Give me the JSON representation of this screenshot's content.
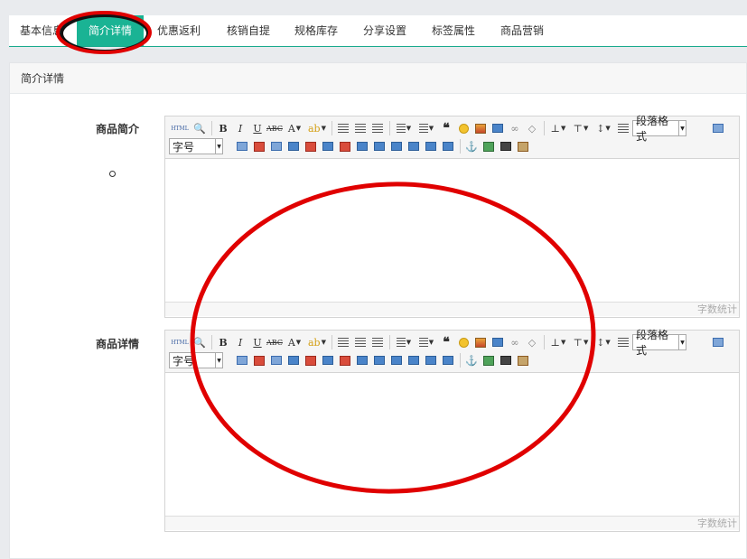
{
  "tabs": [
    {
      "label": "基本信息",
      "active": false
    },
    {
      "label": "简介详情",
      "active": true
    },
    {
      "label": "优惠返利",
      "active": false
    },
    {
      "label": "核销自提",
      "active": false
    },
    {
      "label": "规格库存",
      "active": false
    },
    {
      "label": "分享设置",
      "active": false
    },
    {
      "label": "标签属性",
      "active": false
    },
    {
      "label": "商品营销",
      "active": false
    }
  ],
  "panel": {
    "title": "简介详情"
  },
  "fields": {
    "intro_label": "商品简介",
    "detail_label": "商品详情"
  },
  "editor": {
    "html_label": "HTML",
    "paragraph_format": "段落格式",
    "font_size": "字号",
    "word_count": "字数统计"
  },
  "colors": {
    "accent": "#1ab394",
    "annotation": "#e00000"
  },
  "icons": [
    "html-icon",
    "preview-icon",
    "bold-icon",
    "italic-icon",
    "underline-icon",
    "strikethrough-icon",
    "font-color-icon",
    "highlight-icon",
    "align-left-icon",
    "align-center-icon",
    "align-right-icon",
    "ordered-list-icon",
    "unordered-list-icon",
    "blockquote-icon",
    "emoji-icon",
    "image-icon",
    "video-icon",
    "link-icon",
    "eraser-icon",
    "row-spacing-top-icon",
    "row-spacing-bottom-icon",
    "line-height-icon",
    "format-match-icon",
    "fullscreen-icon"
  ]
}
